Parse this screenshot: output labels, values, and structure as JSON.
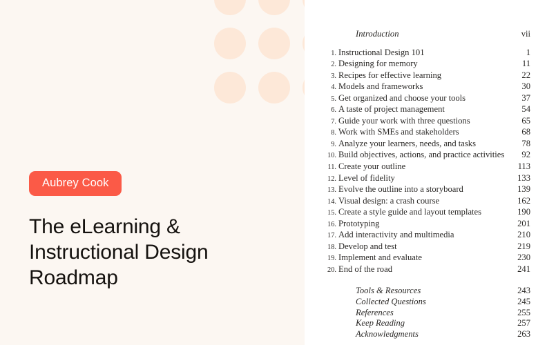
{
  "cover": {
    "author_badge": "Aubrey Cook",
    "title": "The eLearning & Instructional Design Roadmap",
    "background_color": "#FCF7F2",
    "badge_color": "#FB5A47",
    "badge_text_color": "#FFFFFF",
    "title_color": "#15120F",
    "dot_color": "#FDE8D8"
  },
  "toc": {
    "front_matter": [
      {
        "label": "Introduction",
        "page": "vii"
      }
    ],
    "chapters": [
      {
        "num": "1.",
        "label": "Instructional Design 101",
        "page": "1"
      },
      {
        "num": "2.",
        "label": "Designing for memory",
        "page": "11"
      },
      {
        "num": "3.",
        "label": "Recipes for effective learning",
        "page": "22"
      },
      {
        "num": "4.",
        "label": "Models and frameworks",
        "page": "30"
      },
      {
        "num": "5.",
        "label": "Get organized and choose your tools",
        "page": "37"
      },
      {
        "num": "6.",
        "label": "A taste of project management",
        "page": "54"
      },
      {
        "num": "7.",
        "label": "Guide your work with three questions",
        "page": "65"
      },
      {
        "num": "8.",
        "label": "Work with SMEs and stakeholders",
        "page": "68"
      },
      {
        "num": "9.",
        "label": "Analyze your learners, needs, and tasks",
        "page": "78"
      },
      {
        "num": "10.",
        "label": "Build objectives, actions, and practice activities",
        "page": "92"
      },
      {
        "num": "11.",
        "label": "Create your outline",
        "page": "113"
      },
      {
        "num": "12.",
        "label": "Level of fidelity",
        "page": "133"
      },
      {
        "num": "13.",
        "label": "Evolve the outline into a storyboard",
        "page": "139"
      },
      {
        "num": "14.",
        "label": "Visual design: a crash course",
        "page": "162"
      },
      {
        "num": "15.",
        "label": "Create a style guide and layout templates",
        "page": "190"
      },
      {
        "num": "16.",
        "label": "Prototyping",
        "page": "201"
      },
      {
        "num": "17.",
        "label": "Add interactivity and multimedia",
        "page": "210"
      },
      {
        "num": "18.",
        "label": "Develop and test",
        "page": "219"
      },
      {
        "num": "19.",
        "label": "Implement and evaluate",
        "page": "230"
      },
      {
        "num": "20.",
        "label": "End of the road",
        "page": "241"
      }
    ],
    "back_matter": [
      {
        "label": "Tools & Resources",
        "page": "243"
      },
      {
        "label": "Collected Questions",
        "page": "245"
      },
      {
        "label": "References",
        "page": "255"
      },
      {
        "label": "Keep Reading",
        "page": "257"
      },
      {
        "label": "Acknowledgments",
        "page": "263"
      }
    ]
  }
}
